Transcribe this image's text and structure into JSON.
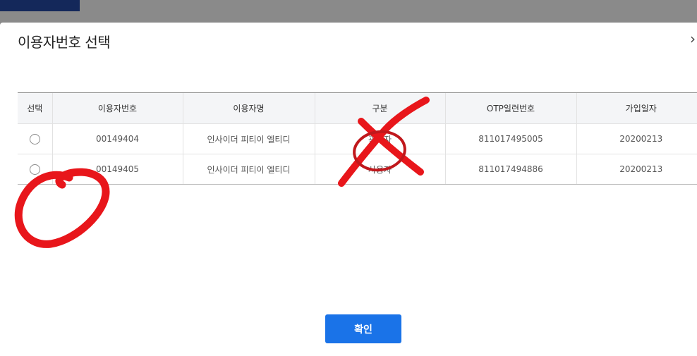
{
  "modal": {
    "title": "이용자번호 선택",
    "close_glyph": "×",
    "confirm_label": "확인"
  },
  "table": {
    "columns": [
      "선택",
      "이용자번호",
      "이용자명",
      "구분",
      "OTP일련번호",
      "가입일자"
    ],
    "rows": [
      {
        "user_no": "00149404",
        "user_name": "인사이더 피티이 엘티디",
        "type": "관리자",
        "otp_serial": "811017495005",
        "join_date": "20200213"
      },
      {
        "user_no": "00149405",
        "user_name": "인사이더 피티이 엘티디",
        "type": "사용자",
        "otp_serial": "811017494886",
        "join_date": "20200213"
      }
    ]
  },
  "colors": {
    "accent": "#1a73e8",
    "annotation": "#e8161b",
    "header_bg": "#f4f5f7"
  },
  "icons": [
    "close-icon",
    "radio-icon"
  ]
}
